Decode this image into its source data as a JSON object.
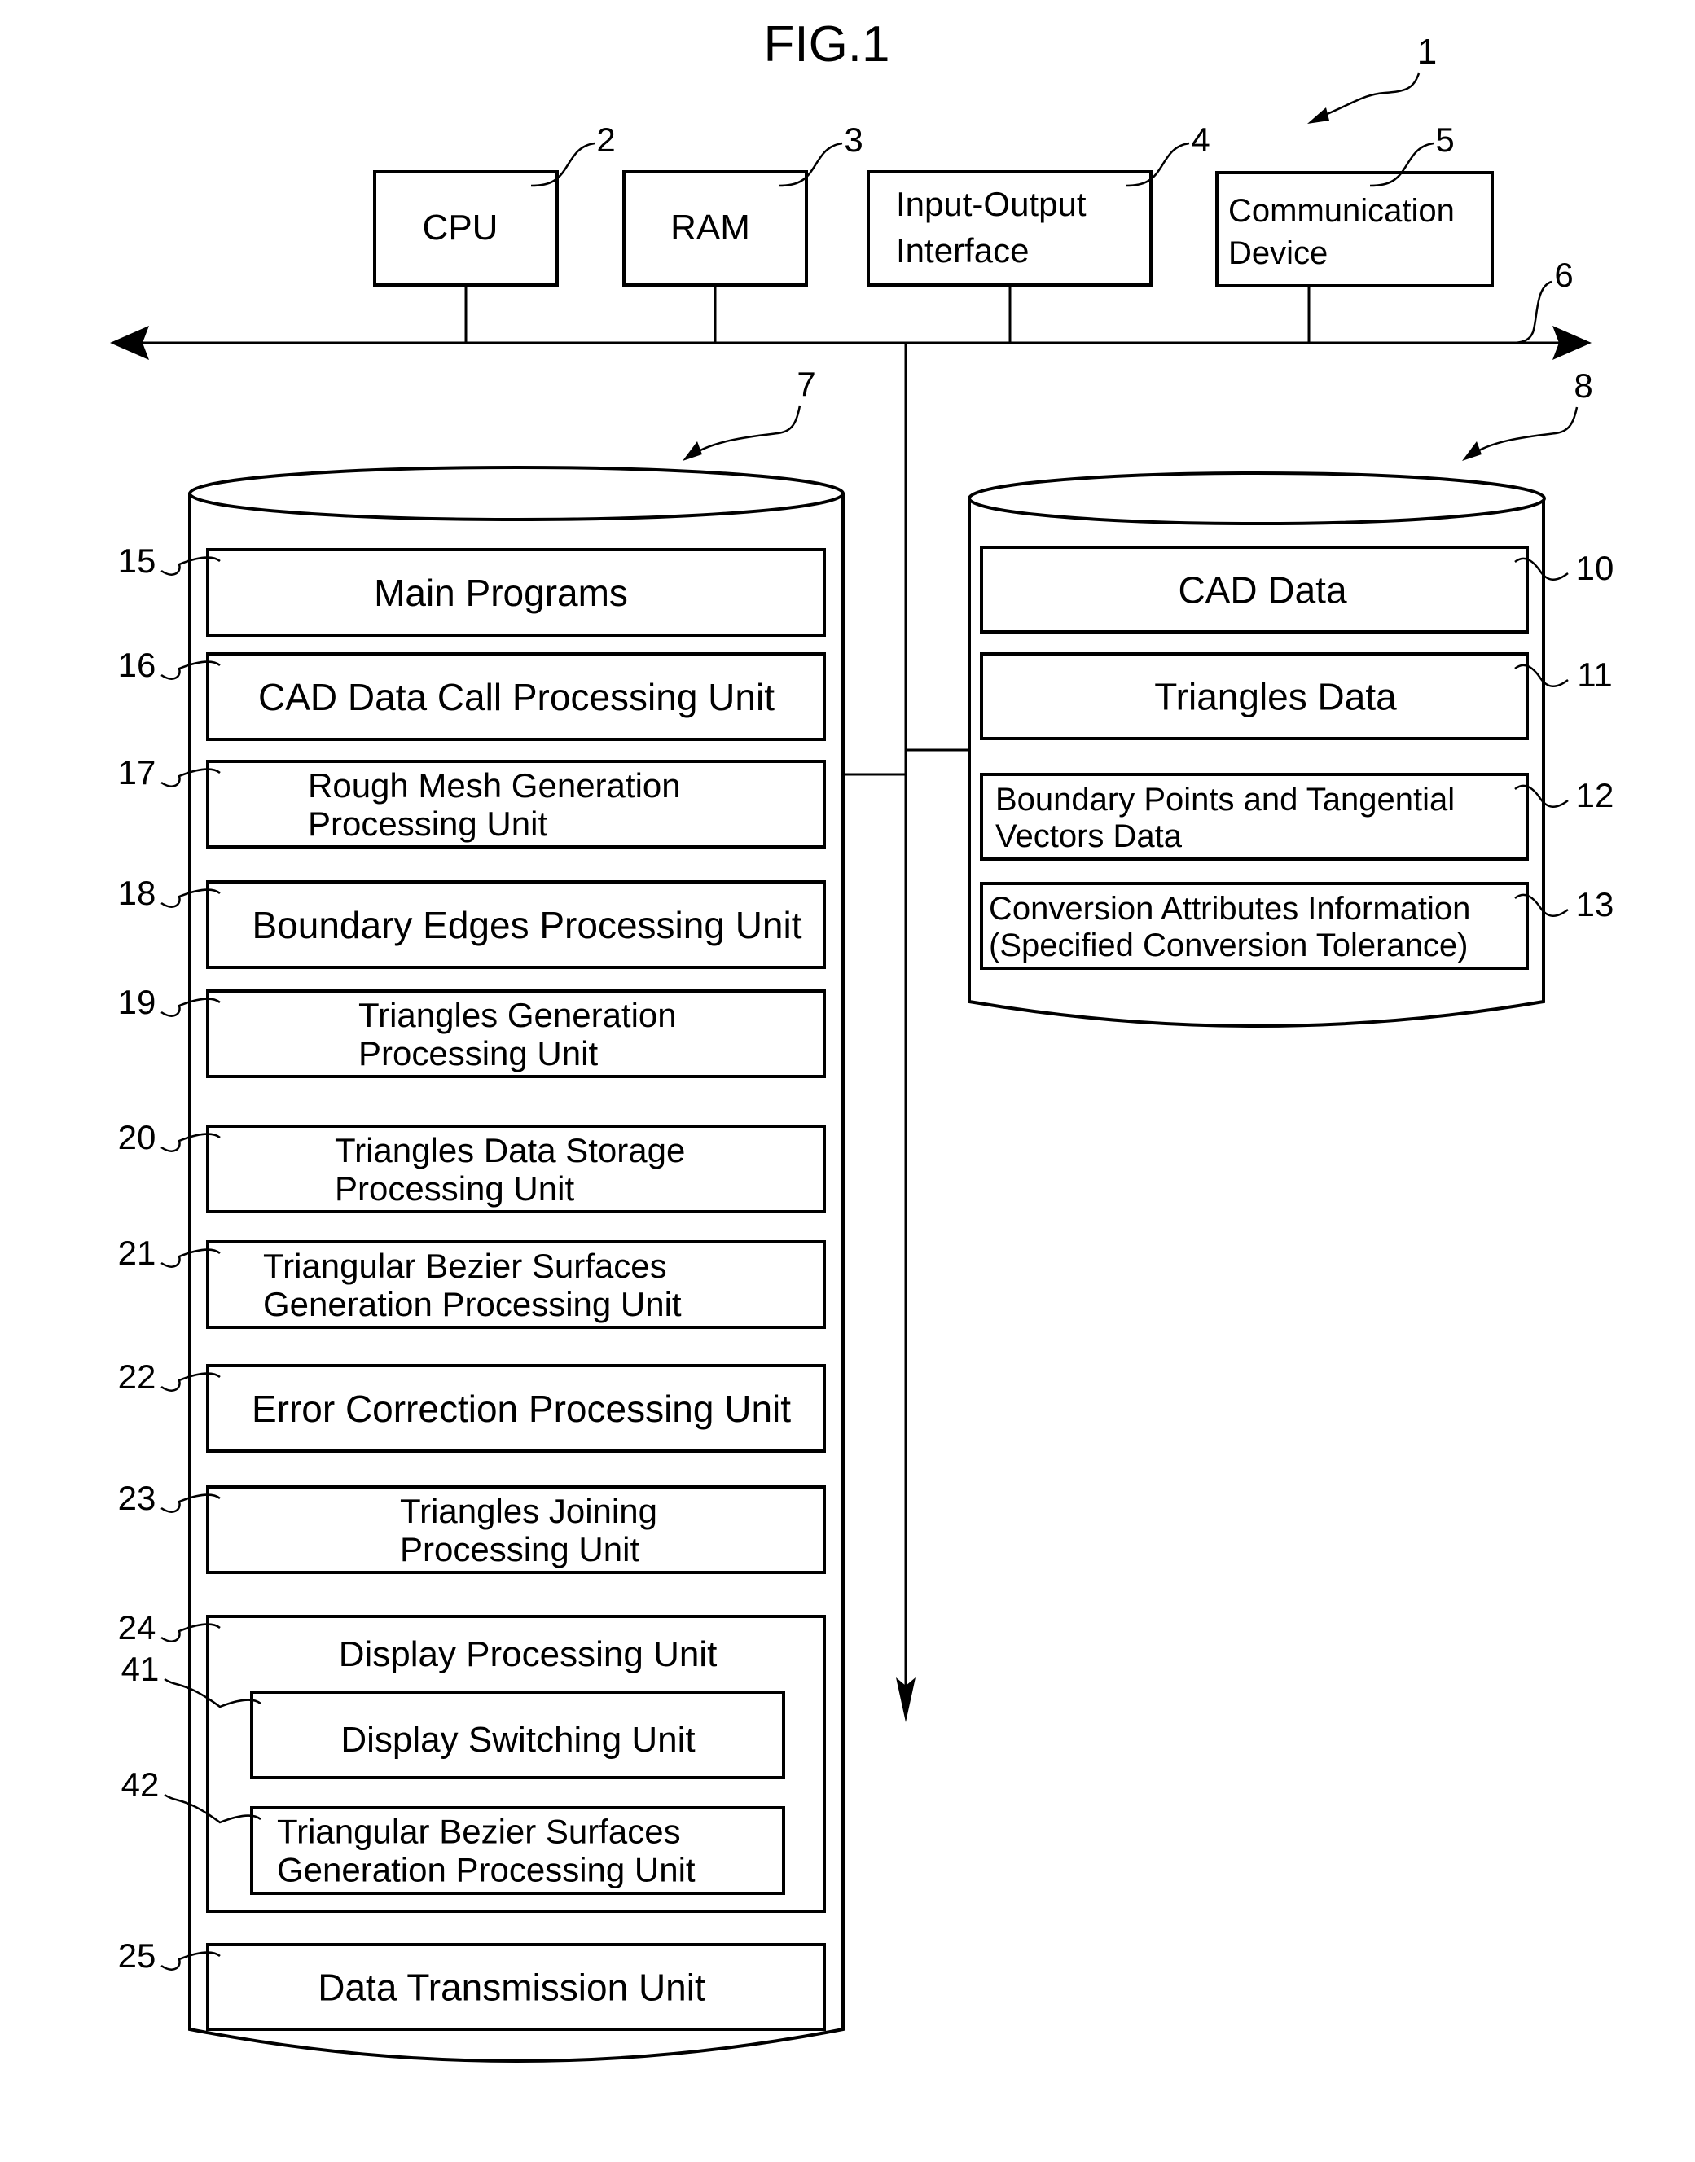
{
  "figure": {
    "title": "FIG.1",
    "system_ref": "1"
  },
  "hardware": [
    {
      "ref": "2",
      "lines": [
        "CPU"
      ]
    },
    {
      "ref": "3",
      "lines": [
        "RAM"
      ]
    },
    {
      "ref": "4",
      "lines": [
        "Input-Output",
        "Interface"
      ]
    },
    {
      "ref": "5",
      "lines": [
        "Communication",
        "Device"
      ]
    }
  ],
  "bus": {
    "ref": "6"
  },
  "program_storage": {
    "ref": "7",
    "units": [
      {
        "ref": "15",
        "lines": [
          "Main Programs"
        ]
      },
      {
        "ref": "16",
        "lines": [
          "CAD Data Call Processing Unit"
        ]
      },
      {
        "ref": "17",
        "lines": [
          "Rough Mesh Generation",
          "Processing Unit"
        ]
      },
      {
        "ref": "18",
        "lines": [
          "Boundary Edges Processing Unit"
        ]
      },
      {
        "ref": "19",
        "lines": [
          "Triangles Generation",
          "Processing Unit"
        ]
      },
      {
        "ref": "20",
        "lines": [
          "Triangles Data Storage",
          "Processing Unit"
        ]
      },
      {
        "ref": "21",
        "lines": [
          "Triangular Bezier Surfaces",
          "Generation Processing Unit"
        ]
      },
      {
        "ref": "22",
        "lines": [
          "Error Correction Processing Unit"
        ]
      },
      {
        "ref": "23",
        "lines": [
          "Triangles Joining",
          "Processing Unit"
        ]
      },
      {
        "ref": "24",
        "lines": [
          "Display Processing Unit"
        ],
        "children": [
          {
            "ref": "41",
            "lines": [
              "Display Switching Unit"
            ]
          },
          {
            "ref": "42",
            "lines": [
              "Triangular Bezier Surfaces",
              "Generation Processing Unit"
            ]
          }
        ]
      },
      {
        "ref": "25",
        "lines": [
          "Data Transmission Unit"
        ]
      }
    ]
  },
  "data_storage": {
    "ref": "8",
    "items": [
      {
        "ref": "10",
        "lines": [
          "CAD Data"
        ]
      },
      {
        "ref": "11",
        "lines": [
          "Triangles Data"
        ]
      },
      {
        "ref": "12",
        "lines": [
          "Boundary Points and Tangential",
          "Vectors Data"
        ]
      },
      {
        "ref": "13",
        "lines": [
          "Conversion Attributes Information",
          "(Specified Conversion Tolerance)"
        ]
      }
    ]
  }
}
